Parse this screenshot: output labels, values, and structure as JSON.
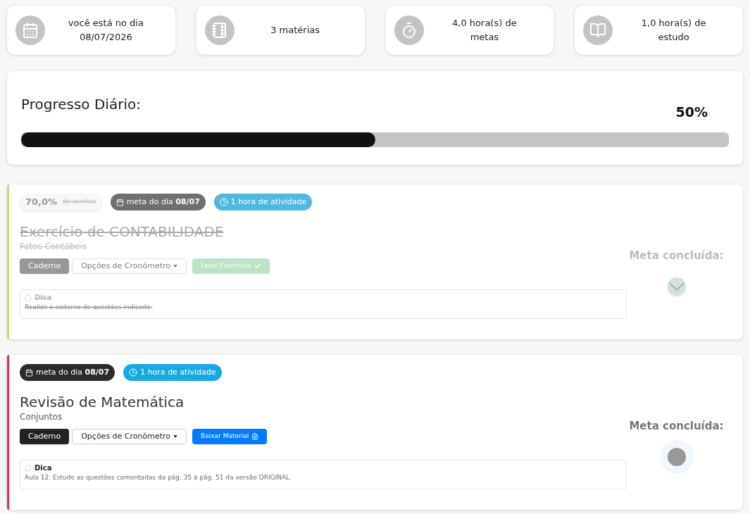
{
  "stats": [
    {
      "kind": "calendar",
      "lines": [
        "você está no dia",
        "08/07/2026"
      ]
    },
    {
      "kind": "notebook",
      "lines": [
        "3 matérias"
      ]
    },
    {
      "kind": "stopwatch",
      "lines": [
        "4,0 hora(s) de",
        "metas"
      ]
    },
    {
      "kind": "book",
      "lines": [
        "1,0 hora(s) de",
        "estudo"
      ]
    }
  ],
  "progress": {
    "title": "Progresso Diário:",
    "reading": "50%",
    "level": 0.5
  },
  "tasks": [
    {
      "done": true,
      "color": "#c9d67a",
      "score": "70,0%",
      "score_label": "de acertos",
      "date_badge": "meta do dia **08/07**",
      "time_badge": "1 hora de atividade",
      "title": "Exercício de CONTABILIDADE",
      "subtitle": "Fatos Contábeis",
      "notebook_button": "Caderno",
      "timer_button": "Opções de Cronômetro",
      "action": {
        "kind": "exercises",
        "label": "Fazer Exercícios"
      },
      "tip_title": "Dica",
      "tip_text": "Realize o caderno de questões indicado.",
      "goal_label": "Meta concluída:"
    },
    {
      "done": false,
      "color": "#dc2d4b",
      "date_badge": "meta do dia **08/07**",
      "time_badge": "1 hora de atividade",
      "title": "Revisão de Matemática",
      "subtitle": "Conjuntos",
      "notebook_button": "Caderno",
      "timer_button": "Opções de Cronômetro",
      "action": {
        "kind": "download",
        "label": "Baixar Material"
      },
      "tip_title": "Dica",
      "tip_text": "Aula 12: Estude as questões comentadas da pág. 35 à pág. 51 da versão ORIGINAL.",
      "goal_label": "Meta concluída:"
    }
  ]
}
